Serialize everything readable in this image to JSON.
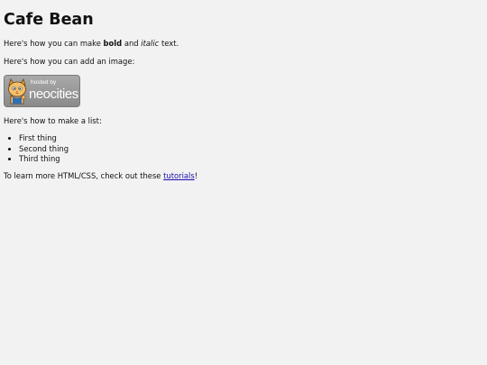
{
  "page": {
    "title": "Cafe Bean",
    "format_line": {
      "prefix": "Here's how you can make ",
      "bold": "bold",
      "middle": " and ",
      "italic": "italic",
      "suffix": " text."
    },
    "image_line": "Here's how you can add an image:",
    "badge": {
      "small": "hosted by",
      "big": "neocities"
    },
    "list_line": "Here's how to make a list:",
    "list_items": [
      "First thing",
      "Second thing",
      "Third thing"
    ],
    "learn_line": {
      "prefix": "To learn more HTML/CSS, check out these ",
      "link": "tutorials",
      "suffix": "!"
    }
  }
}
